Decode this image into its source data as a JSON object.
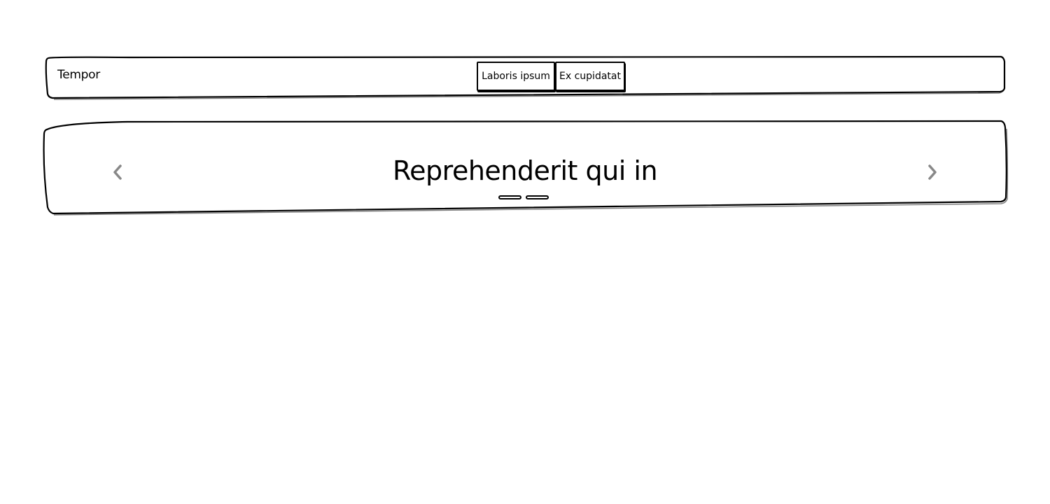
{
  "navbar": {
    "brand": "Tempor",
    "buttons": [
      {
        "label": "Laboris ipsum"
      },
      {
        "label": "Ex cupidatat"
      }
    ]
  },
  "carousel": {
    "slide_title": "Reprehenderit qui in",
    "prev_icon": "chevron-left-icon",
    "next_icon": "chevron-right-icon",
    "slide_count": 2,
    "arrow_color": "#888888"
  }
}
